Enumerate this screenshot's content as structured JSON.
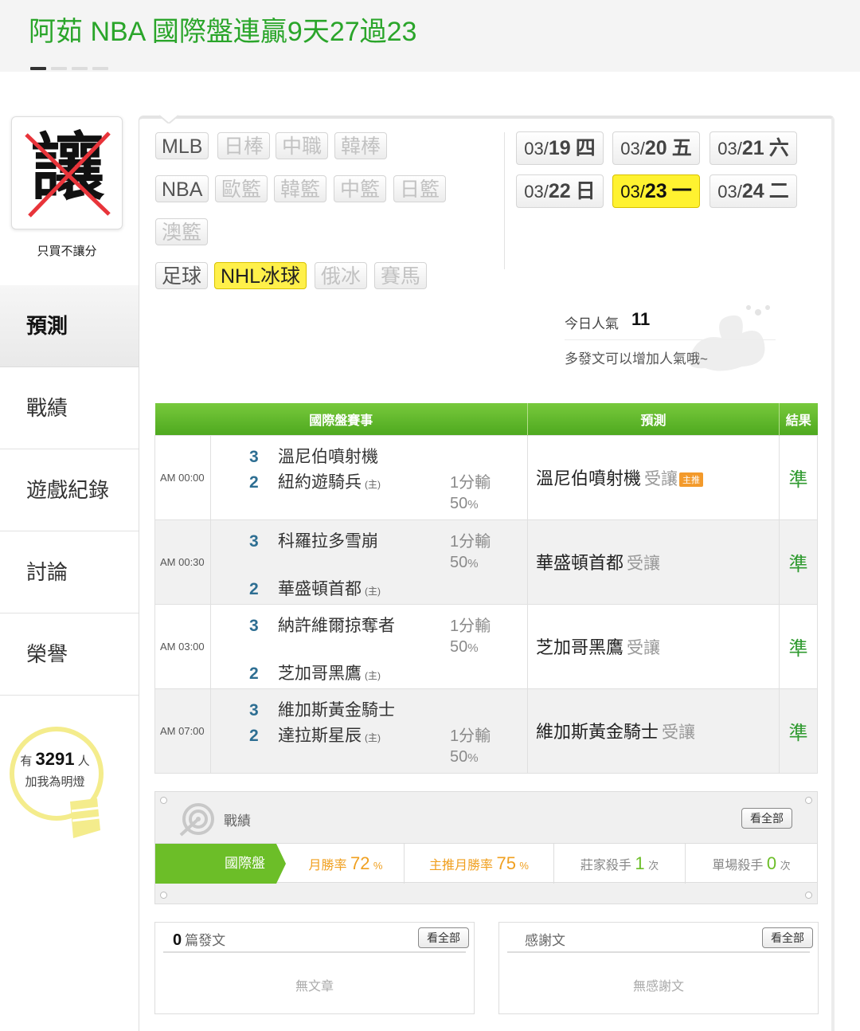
{
  "header": {
    "title": "阿茹 NBA 國際盤連贏9天27過23"
  },
  "profile": {
    "avatar_char": "讓",
    "caption": "只買不讓分"
  },
  "sidebar": {
    "items": [
      {
        "label": "預測"
      },
      {
        "label": "戰績"
      },
      {
        "label": "遊戲紀錄"
      },
      {
        "label": "討論"
      },
      {
        "label": "榮譽"
      }
    ]
  },
  "fans": {
    "prefix": "有",
    "count": "3291",
    "suffix": "人",
    "sub": "加我為明燈"
  },
  "categories": {
    "row1": [
      "MLB",
      "日棒",
      "中職",
      "韓棒"
    ],
    "row2": [
      "NBA",
      "歐籃",
      "韓籃",
      "中籃",
      "日籃"
    ],
    "row3": [
      "澳籃"
    ],
    "row4": [
      "足球",
      "NHL冰球",
      "俄冰",
      "賽馬"
    ]
  },
  "dates": [
    {
      "md": "03/",
      "d": "19",
      "w": "四"
    },
    {
      "md": "03/",
      "d": "20",
      "w": "五"
    },
    {
      "md": "03/",
      "d": "21",
      "w": "六"
    },
    {
      "md": "03/",
      "d": "22",
      "w": "日"
    },
    {
      "md": "03/",
      "d": "23",
      "w": "一"
    },
    {
      "md": "03/",
      "d": "24",
      "w": "二"
    }
  ],
  "popularity": {
    "label": "今日人氣",
    "value": "11",
    "hint": "多發文可以增加人氣哦~"
  },
  "table": {
    "headers": [
      "國際盤賽事",
      "預測",
      "結果"
    ],
    "home_mark": "(主)",
    "rows": [
      {
        "time": "AM 00:00",
        "away_score": "3",
        "away": "溫尼伯噴射機",
        "home_score": "2",
        "home": "紐約遊騎兵",
        "odds": "1分輸",
        "pct": "50",
        "pct_unit": "%",
        "pick": "溫尼伯噴射機",
        "pick_type": "受讓",
        "badge": "主推",
        "result": "準"
      },
      {
        "time": "AM 00:30",
        "away_score": "3",
        "away": "科羅拉多雪崩",
        "home_score": "2",
        "home": "華盛頓首都",
        "odds": "1分輸",
        "pct": "50",
        "pct_unit": "%",
        "pick": "華盛頓首都",
        "pick_type": "受讓",
        "result": "準"
      },
      {
        "time": "AM 03:00",
        "away_score": "3",
        "away": "納許維爾掠奪者",
        "home_score": "2",
        "home": "芝加哥黑鷹",
        "odds": "1分輸",
        "pct": "50",
        "pct_unit": "%",
        "pick": "芝加哥黑鷹",
        "pick_type": "受讓",
        "result": "準"
      },
      {
        "time": "AM 07:00",
        "away_score": "3",
        "away": "維加斯黃金騎士",
        "home_score": "2",
        "home": "達拉斯星辰",
        "odds": "1分輸",
        "pct": "50",
        "pct_unit": "%",
        "pick": "維加斯黃金騎士",
        "pick_type": "受讓",
        "result": "準"
      }
    ]
  },
  "record": {
    "title": "戰績",
    "view_all": "看全部",
    "active_tab": "國際盤",
    "month_win_label": "月勝率",
    "month_win_value": "72",
    "month_win_unit": "%",
    "main_win_label": "主推月勝率",
    "main_win_value": "75",
    "main_win_unit": "%",
    "banker_label": "莊家殺手",
    "banker_value": "1",
    "banker_unit": "次",
    "single_label": "單場殺手",
    "single_value": "0",
    "single_unit": "次"
  },
  "posts": {
    "count": "0",
    "label": "篇發文",
    "view_all": "看全部",
    "empty": "無文章"
  },
  "thanks": {
    "label": "感謝文",
    "view_all": "看全部",
    "empty": "無感謝文"
  },
  "colors": {
    "brand_green": "#2aa52a",
    "header_green": "#5cb02a",
    "highlight_yellow": "#fff230",
    "result_green": "#2f9a2f",
    "score_blue": "#2d6e92",
    "win_green": "#6cbe28",
    "main_orange": "#f39a2b"
  }
}
